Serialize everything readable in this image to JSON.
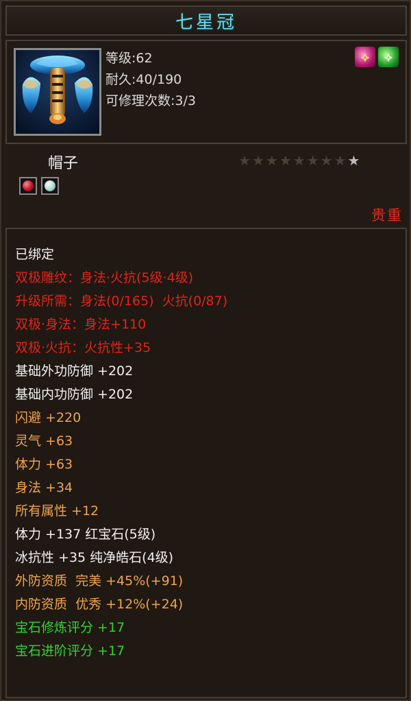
{
  "title": "七星冠",
  "item": {
    "icon": "hat-icon",
    "level": "等级:62",
    "durability": "耐久:40/190",
    "repairs": "可修理次数:3/3"
  },
  "badges": [
    {
      "icon": "red-rune-badge",
      "glyph": "⟡"
    },
    {
      "icon": "green-rune-badge",
      "glyph": "⟡"
    }
  ],
  "type_name": "帽子",
  "stars": {
    "lit": 1,
    "total": 9
  },
  "gems": [
    {
      "icon": "red-gem-icon"
    },
    {
      "icon": "white-gem-icon"
    }
  ],
  "rarity": "贵重",
  "colors": {
    "white": "#f2f2f2",
    "red": "#e0251a",
    "orange": "#f0a54a",
    "green": "#2fd62f",
    "title": "#6fd9e8"
  },
  "attributes": [
    {
      "text": "已绑定",
      "color": "white"
    },
    {
      "text": "双极雕纹：身法·火抗(5级·4级)",
      "color": "red"
    },
    {
      "text": "升级所需：身法(0/165)  火抗(0/87)",
      "color": "red"
    },
    {
      "text": "双极·身法：身法+110",
      "color": "red"
    },
    {
      "text": "双极·火抗：火抗性+35",
      "color": "red"
    },
    {
      "text": "基础外功防御 +202",
      "color": "white"
    },
    {
      "text": "基础内功防御 +202",
      "color": "white"
    },
    {
      "text": "闪避 +220",
      "color": "orange"
    },
    {
      "text": "灵气 +63",
      "color": "orange"
    },
    {
      "text": "体力 +63",
      "color": "orange"
    },
    {
      "text": "身法 +34",
      "color": "orange"
    },
    {
      "text": "所有属性 +12",
      "color": "orange"
    },
    {
      "text": "体力 +137 红宝石(5级)",
      "color": "white"
    },
    {
      "text": "冰抗性 +35 纯净皓石(4级)",
      "color": "white"
    },
    {
      "text": "外防资质  完美 +45%(+91)",
      "color": "orange"
    },
    {
      "text": "内防资质  优秀 +12%(+24)",
      "color": "orange"
    },
    {
      "text": "宝石修炼评分 +17",
      "color": "green"
    },
    {
      "text": "宝石进阶评分 +17",
      "color": "green"
    }
  ]
}
